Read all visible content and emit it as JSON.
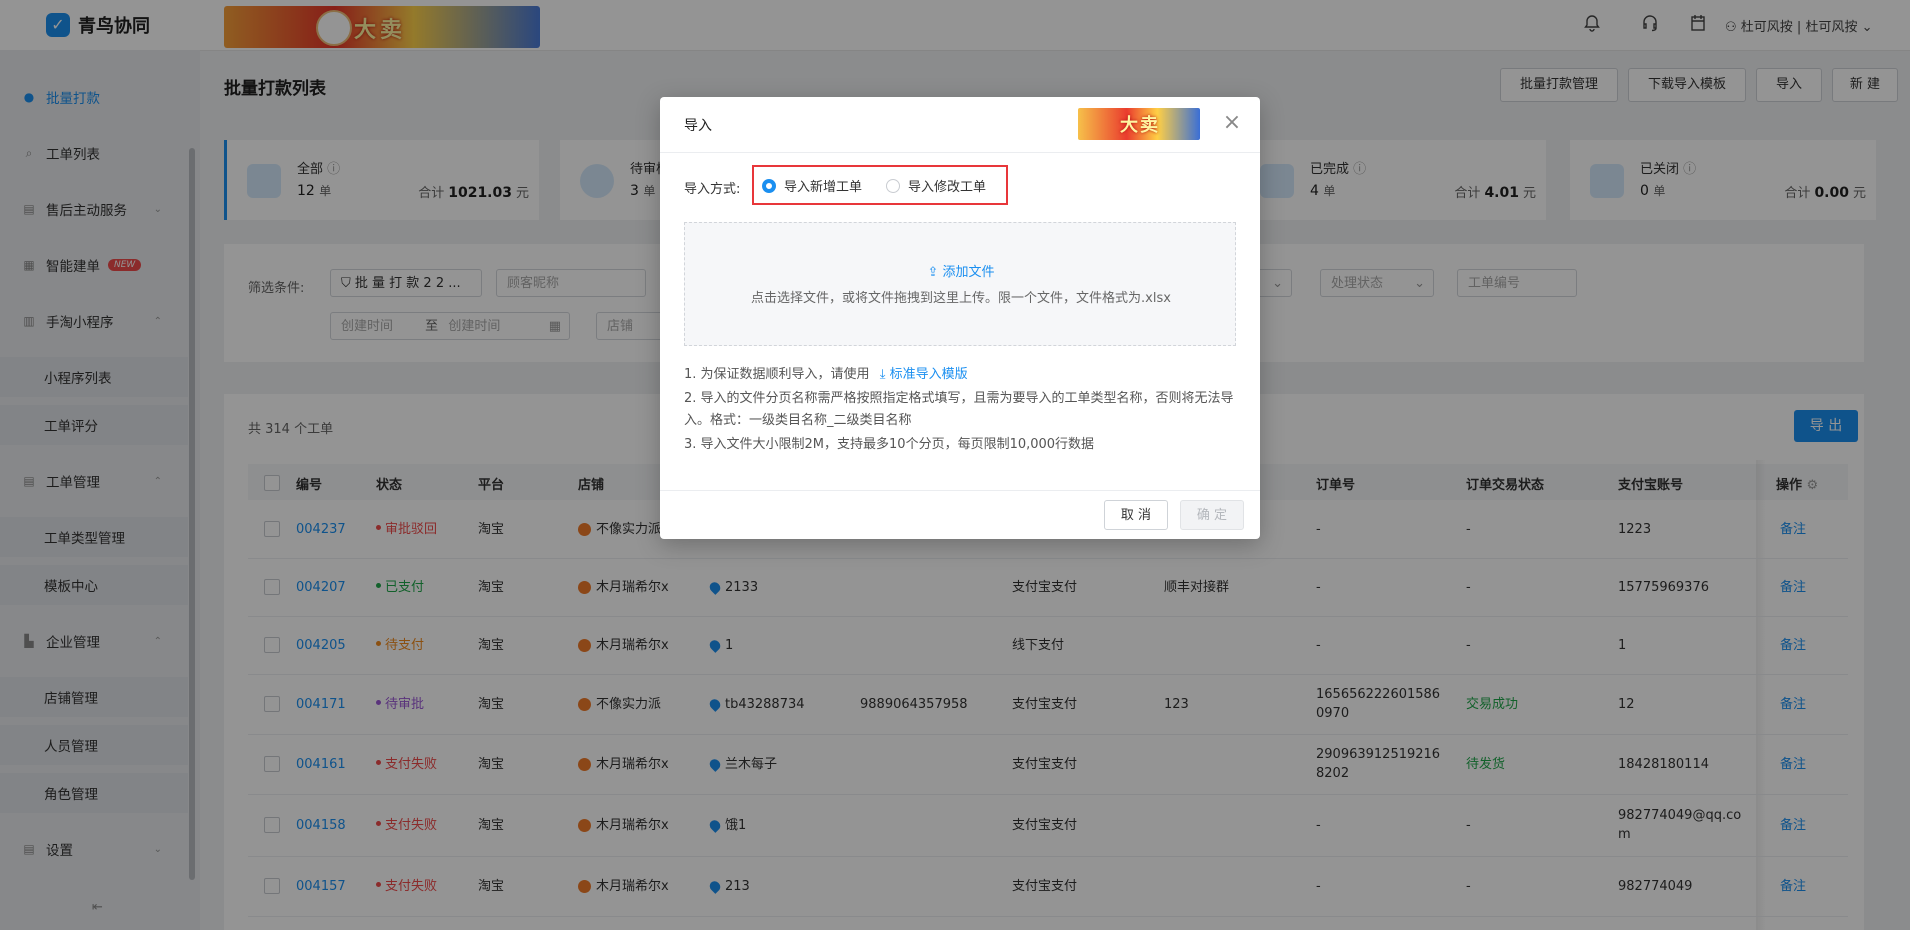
{
  "app": {
    "name": "青鸟协同"
  },
  "banner": {
    "text": "大卖"
  },
  "topbar": {
    "user": "杜可风按 | 杜可风按"
  },
  "sidebar": {
    "items": [
      {
        "label": "批量打款"
      },
      {
        "label": "工单列表"
      },
      {
        "label": "售后主动服务"
      },
      {
        "label": "智能建单",
        "badge": "NEW"
      },
      {
        "label": "手淘小程序"
      },
      {
        "label": "小程序列表"
      },
      {
        "label": "工单评分"
      },
      {
        "label": "工单管理"
      },
      {
        "label": "工单类型管理"
      },
      {
        "label": "模板中心"
      },
      {
        "label": "企业管理"
      },
      {
        "label": "店铺管理"
      },
      {
        "label": "人员管理"
      },
      {
        "label": "角色管理"
      },
      {
        "label": "设置"
      }
    ]
  },
  "page": {
    "title": "批量打款列表",
    "buttons": {
      "manage": "批量打款管理",
      "download": "下载导入模板",
      "import": "导入",
      "create": "新 建"
    }
  },
  "stats": [
    {
      "name": "全部",
      "count": "12",
      "unit": "单",
      "sum_label": "合计",
      "sum": "1021.03",
      "currency": "元"
    },
    {
      "name": "待审核",
      "count": "3",
      "unit": "单"
    },
    {
      "name": "已完成",
      "count": "4",
      "unit": "单",
      "sum_label": "合计",
      "sum": "4.01",
      "currency": "元"
    },
    {
      "name": "已关闭",
      "count": "0",
      "unit": "单",
      "sum_label": "合计",
      "sum": "0.00",
      "currency": "元"
    }
  ],
  "filters": {
    "label": "筛选条件:",
    "batch": "批 量 打 款 2 2 ...",
    "nick_placeholder": "顾客昵称",
    "start_placeholder": "创建时间",
    "range_sep": "至",
    "end_placeholder": "创建时间",
    "shop_placeholder": "店铺",
    "process_placeholder": "处理状态",
    "order_placeholder": "工单编号"
  },
  "table": {
    "total": "共 314 个工单",
    "export": "导 出",
    "headers": {
      "id": "编号",
      "status": "状态",
      "platform": "平台",
      "shop": "店铺",
      "order_no": "订单号",
      "trade_status": "订单交易状态",
      "alipay": "支付宝账号",
      "ops": "操作"
    },
    "rows": [
      {
        "id": "004237",
        "status": "审批驳回",
        "status_color": "#ef4b4b",
        "platform": "淘宝",
        "shop": "不像实力派",
        "buyer": "",
        "phone": "",
        "pay": "",
        "note": "",
        "order": "-",
        "trade": "-",
        "trade_color": "#333333",
        "alipay": "1223",
        "op": "备注"
      },
      {
        "id": "004207",
        "status": "已支付",
        "status_color": "#20a84a",
        "platform": "淘宝",
        "shop": "木月瑞希尔x",
        "buyer": "2133",
        "phone": "",
        "pay": "支付宝支付",
        "note": "顺丰对接群",
        "order": "-",
        "trade": "-",
        "trade_color": "#333333",
        "alipay": "15775969376",
        "op": "备注"
      },
      {
        "id": "004205",
        "status": "待支付",
        "status_color": "#f08a1e",
        "platform": "淘宝",
        "shop": "木月瑞希尔x",
        "buyer": "1",
        "phone": "",
        "pay": "线下支付",
        "note": "",
        "order": "-",
        "trade": "-",
        "trade_color": "#333333",
        "alipay": "1",
        "op": "备注"
      },
      {
        "id": "004171",
        "status": "待审批",
        "status_color": "#9b59d6",
        "platform": "淘宝",
        "shop": "不像实力派",
        "buyer": "tb43288734",
        "phone": "9889064357958",
        "pay": "支付宝支付",
        "note": "123",
        "order": "1656562226015860970",
        "trade": "交易成功",
        "trade_color": "#20a84a",
        "alipay": "12",
        "op": "备注"
      },
      {
        "id": "004161",
        "status": "支付失败",
        "status_color": "#ef4b4b",
        "platform": "淘宝",
        "shop": "木月瑞希尔x",
        "buyer": "兰木每子",
        "phone": "",
        "pay": "支付宝支付",
        "note": "",
        "order": "2909639125192168202",
        "trade": "待发货",
        "trade_color": "#20a84a",
        "alipay": "18428180114",
        "op": "备注"
      },
      {
        "id": "004158",
        "status": "支付失败",
        "status_color": "#ef4b4b",
        "platform": "淘宝",
        "shop": "木月瑞希尔x",
        "buyer": "饿1",
        "phone": "",
        "pay": "支付宝支付",
        "note": "",
        "order": "-",
        "trade": "-",
        "trade_color": "#333333",
        "alipay": "982774049@qq.com",
        "op": "备注"
      },
      {
        "id": "004157",
        "status": "支付失败",
        "status_color": "#ef4b4b",
        "platform": "淘宝",
        "shop": "木月瑞希尔x",
        "buyer": "213",
        "phone": "",
        "pay": "支付宝支付",
        "note": "",
        "order": "-",
        "trade": "-",
        "trade_color": "#333333",
        "alipay": "982774049",
        "op": "备注"
      }
    ]
  },
  "modal": {
    "title": "导入",
    "banner_text": "大卖",
    "mode_label": "导入方式:",
    "option_new": "导入新增工单",
    "option_edit": "导入修改工单",
    "add_file": "添加文件",
    "drop_hint": "点击选择文件，或将文件拖拽到这里上传。限一个文件，文件格式为.xlsx",
    "note1": "1. 为保证数据顺利导入，请使用",
    "note1_link": "标准导入模版",
    "note2": "2. 导入的文件分页名称需严格按照指定格式填写，且需为要导入的工单类型名称，否则将无法导入。格式：一级类目名称_二级类目名称",
    "note3": "3. 导入文件大小限制2M，支持最多10个分页，每页限制10,000行数据",
    "cancel": "取 消",
    "ok": "确 定"
  },
  "colors": {
    "accent": "#1b8ff0",
    "highlight": "#e8363a"
  }
}
